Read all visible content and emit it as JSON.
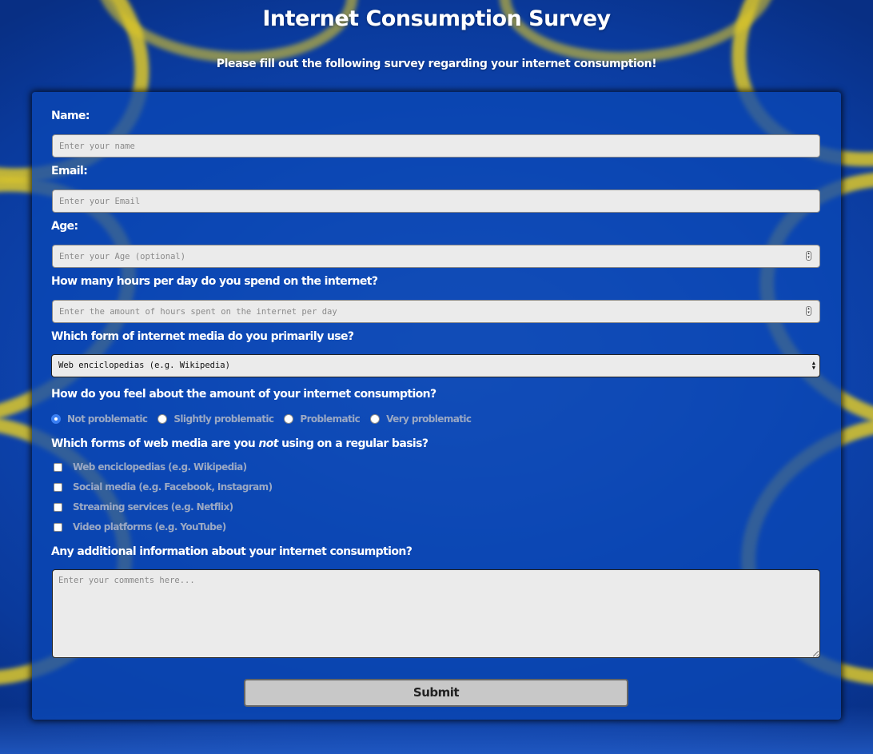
{
  "page": {
    "title": "Internet Consumption Survey",
    "description": "Please fill out the following survey regarding your internet consumption!"
  },
  "form": {
    "name": {
      "label": "Name:",
      "placeholder": "Enter your name",
      "value": ""
    },
    "email": {
      "label": "Email:",
      "placeholder": "Enter your Email",
      "value": ""
    },
    "age": {
      "label": "Age:",
      "placeholder": "Enter your Age (optional)",
      "value": ""
    },
    "hours": {
      "label": "How many hours per day do you spend on the internet?",
      "placeholder": "Enter the amount of hours spent on the internet per day",
      "value": ""
    },
    "media": {
      "label": "Which form of internet media do you primarily use?",
      "selected": "Web enciclopedias (e.g. Wikipedia)"
    },
    "feeling": {
      "label": "How do you feel about the amount of your internet consumption?",
      "options": [
        {
          "label": "Not problematic",
          "checked": true
        },
        {
          "label": "Slightly problematic",
          "checked": false
        },
        {
          "label": "Problematic",
          "checked": false
        },
        {
          "label": "Very problematic",
          "checked": false
        }
      ]
    },
    "not_used": {
      "label_before": "Which forms of web media are you",
      "label_emphasis": "not",
      "label_after": "using on a regular basis?",
      "options": [
        {
          "label": "Web enciclopedias (e.g. Wikipedia)",
          "checked": false
        },
        {
          "label": "Social media (e.g. Facebook, Instagram)",
          "checked": false
        },
        {
          "label": "Streaming services (e.g. Netflix)",
          "checked": false
        },
        {
          "label": "Video platforms (e.g. YouTube)",
          "checked": false
        }
      ]
    },
    "comments": {
      "label": "Any additional information about your internet consumption?",
      "placeholder": "Enter your comments here...",
      "value": ""
    },
    "submit_label": "Submit"
  },
  "colors": {
    "panel_background": "#0a46b4",
    "accent_radio": "#3b7ff2",
    "input_background": "#ebebeb",
    "muted_option_text": "#9aa8c4",
    "cable_yellow": "#dec828"
  }
}
